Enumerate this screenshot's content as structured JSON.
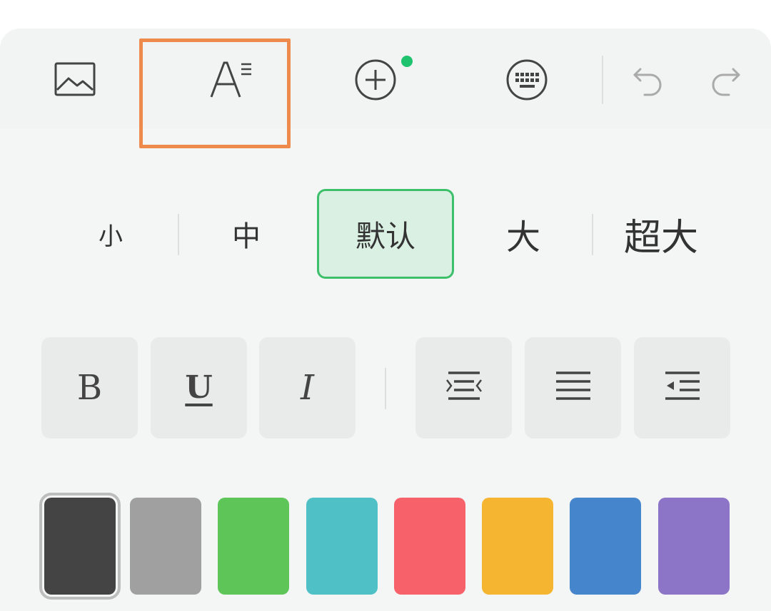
{
  "toolbar": {
    "icons": {
      "image": "image-icon",
      "text_style": "text-style-icon",
      "add": "add-circle-icon",
      "keyboard": "keyboard-icon",
      "undo": "undo-icon",
      "redo": "redo-icon"
    },
    "text_style_glyph": "A",
    "add_has_badge": true,
    "highlight_color": "#ee8a4c",
    "badge_color": "#1fc36e"
  },
  "font_size": {
    "options": [
      "小",
      "中",
      "默认",
      "大",
      "超大"
    ],
    "selected": "默认"
  },
  "format": {
    "bold_label": "B",
    "underline_label": "U",
    "italic_label": "I",
    "icons": {
      "align_center": "align-center-icon",
      "align_justify": "align-justify-icon",
      "indent": "indent-icon"
    }
  },
  "colors": {
    "swatches": [
      "#444444",
      "#a0a0a0",
      "#5ec659",
      "#4fc1c6",
      "#f6616a",
      "#f6b530",
      "#4585cb",
      "#8c74c6"
    ],
    "selected_index": 0
  }
}
